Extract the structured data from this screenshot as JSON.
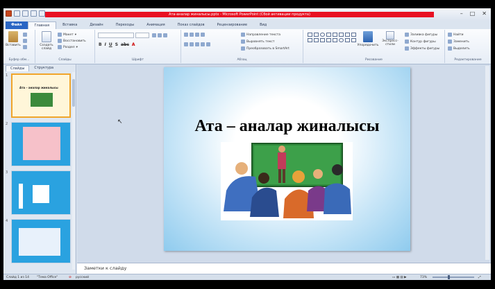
{
  "window": {
    "title": "Ата-аналар жиналысы.pptx - Microsoft PowerPoint (Сбой активации продукта)"
  },
  "ribbon_tabs": [
    {
      "label": "Файл"
    },
    {
      "label": "Главная"
    },
    {
      "label": "Вставка"
    },
    {
      "label": "Дизайн"
    },
    {
      "label": "Переходы"
    },
    {
      "label": "Анимация"
    },
    {
      "label": "Показ слайдов"
    },
    {
      "label": "Рецензирование"
    },
    {
      "label": "Вид"
    }
  ],
  "ribbon": {
    "clipboard": {
      "paste": "Вставить",
      "group": "Буфер обм..."
    },
    "slides": {
      "new_slide": "Создать слайд",
      "layout": "Макет",
      "reset": "Восстановить",
      "section": "Раздел",
      "group": "Слайды"
    },
    "font": {
      "group": "Шрифт"
    },
    "paragraph": {
      "text_direction": "Направление текста",
      "align_text": "Выровнять текст",
      "smartart": "Преобразовать в SmartArt",
      "group": "Абзац"
    },
    "drawing": {
      "arrange": "Упорядочить",
      "quick_styles": "Экспресс-стили",
      "fill": "Заливка фигуры",
      "outline": "Контур фигуры",
      "effects": "Эффекты фигуры",
      "group": "Рисование"
    },
    "editing": {
      "find": "Найти",
      "replace": "Заменить",
      "select": "Выделить",
      "group": "Редактирование"
    }
  },
  "left_panel": {
    "tabs": [
      {
        "label": "Слайды"
      },
      {
        "label": "Структура"
      }
    ],
    "thumbs": [
      {
        "num": "1",
        "caption": "Ата – аналар жиналысы"
      },
      {
        "num": "2",
        "caption": ""
      },
      {
        "num": "3",
        "caption": ""
      },
      {
        "num": "4",
        "caption": ""
      }
    ]
  },
  "slide": {
    "title": "Ата – аналар жиналысы"
  },
  "notes": {
    "placeholder": "Заметки к слайду"
  },
  "status": {
    "slide_info": "Слайд 1 из 14",
    "theme": "\"Тема Office\"",
    "language": "русский",
    "zoom": "73%"
  },
  "colors": {
    "file_tab": "#2a66c4",
    "title_bar_alert": "#e81123",
    "thumb_bg": "#2aa2e0",
    "selection": "#f0a52a"
  }
}
